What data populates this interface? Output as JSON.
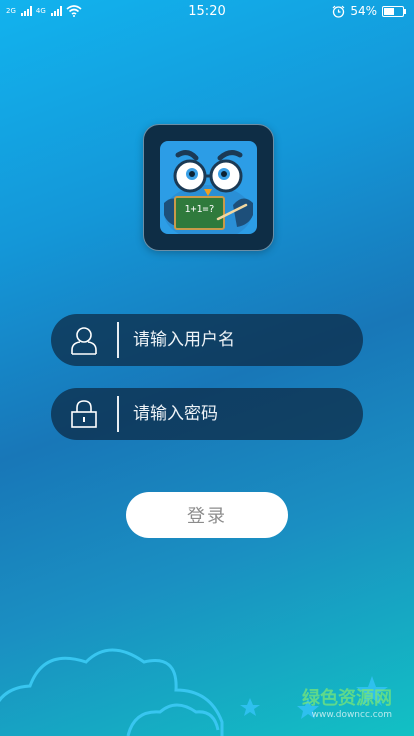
{
  "status_bar": {
    "network_left": "2G",
    "network_right": "4G",
    "time": "15:20",
    "battery_percent": "54%",
    "battery_level": 0.54,
    "icons": [
      "signal-icon",
      "signal-icon",
      "wifi-icon",
      "alarm-icon",
      "battery-icon"
    ]
  },
  "logo": {
    "board_text": "1+1=?",
    "icon": "owl-teacher-logo"
  },
  "form": {
    "username_placeholder": "请输入用户名",
    "password_placeholder": "请输入密码",
    "username_icon": "user-icon",
    "password_icon": "lock-icon",
    "login_label": "登录"
  },
  "watermark": {
    "title": "绿色资源网",
    "url": "www.downcc.com"
  },
  "colors": {
    "field_bg": "#0c2842",
    "button_bg": "#ffffff",
    "button_text": "#8c8c8c"
  }
}
